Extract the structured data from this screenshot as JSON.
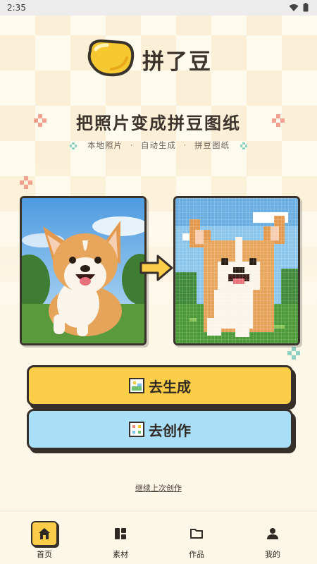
{
  "status_bar": {
    "time": "2:35"
  },
  "brand": {
    "name": "拼了豆"
  },
  "hero": {
    "headline": "把照片变成拼豆图纸",
    "features": [
      "本地照片",
      "自动生成",
      "拼豆图纸"
    ],
    "separator": "·"
  },
  "actions": {
    "generate_label": "去生成",
    "create_label": "去创作",
    "continue_label": "继续上次创作"
  },
  "nav": {
    "items": [
      {
        "label": "首页",
        "icon": "home-icon",
        "active": true
      },
      {
        "label": "素材",
        "icon": "grid-icon",
        "active": false
      },
      {
        "label": "作品",
        "icon": "folder-icon",
        "active": false
      },
      {
        "label": "我的",
        "icon": "person-icon",
        "active": false
      }
    ]
  },
  "colors": {
    "accent_yellow": "#fccd49",
    "accent_blue": "#a9def7",
    "outline": "#37302a",
    "background": "#fdf7e8"
  }
}
